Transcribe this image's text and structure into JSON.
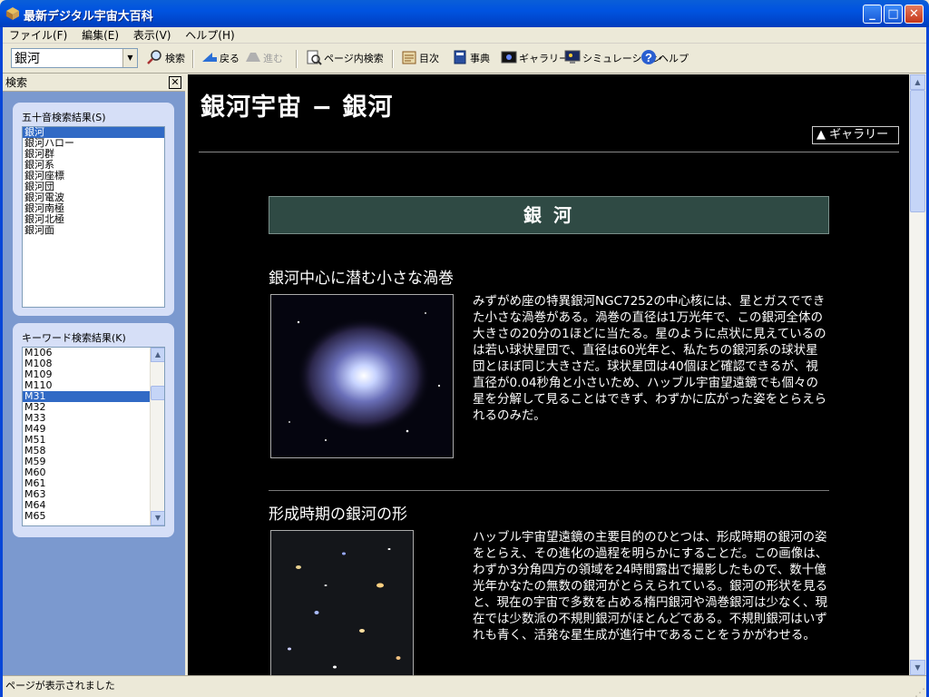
{
  "window": {
    "title": "最新デジタル宇宙大百科",
    "minimize": "_",
    "maximize": "□",
    "close": "✕"
  },
  "menu": [
    "ファイル(F)",
    "編集(E)",
    "表示(V)",
    "ヘルプ(H)"
  ],
  "toolbar": {
    "search_value": "銀河",
    "search": "検索",
    "back": "戻る",
    "forward": "進む",
    "page_search": "ページ内検索",
    "toc": "目次",
    "dictionary": "事典",
    "gallery": "ギャラリー",
    "simulation": "シミュレーション",
    "help": "ヘルプ"
  },
  "search_pane": {
    "title": "検索",
    "kana_label": "五十音検索結果(S)",
    "kana_results": [
      "銀河",
      "銀河ハロー",
      "銀河群",
      "銀河系",
      "銀河座標",
      "銀河団",
      "銀河電波",
      "銀河南極",
      "銀河北極",
      "銀河面"
    ],
    "kana_selected": 0,
    "keyword_label": "キーワード検索結果(K)",
    "keyword_results": [
      "M106",
      "M108",
      "M109",
      "M110",
      "M31",
      "M32",
      "M33",
      "M49",
      "M51",
      "M58",
      "M59",
      "M60",
      "M61",
      "M63",
      "M64",
      "M65"
    ],
    "keyword_selected": 4
  },
  "page": {
    "heading": "銀河宇宙 − 銀河",
    "gallery_link": "▲ ギャラリー",
    "section_title": "銀 河",
    "articles": [
      {
        "title": "銀河中心に潜む小さな渦巻",
        "text": "みずがめ座の特異銀河NGC7252の中心核には、星とガスでできた小さな渦巻がある。渦巻の直径は1万光年で、この銀河全体の大きさの20分の1ほどに当たる。星のように点状に見えているのは若い球状星団で、直径は60光年と、私たちの銀河系の球状星団とほぼ同じ大きさだ。球状星団は40個ほど確認できるが、視直径が0.04秒角と小さいため、ハッブル宇宙望遠鏡でも個々の星を分解して見ることはできず、わずかに広がった姿をとらえられるのみだ。"
      },
      {
        "title": "形成時期の銀河の形",
        "text": "ハッブル宇宙望遠鏡の主要目的のひとつは、形成時期の銀河の姿をとらえ、その進化の過程を明らかにすることだ。この画像は、わずか3分角四方の領域を24時間露出で撮影したもので、数十億光年かなたの無数の銀河がとらえられている。銀河の形状を見ると、現在の宇宙で多数を占める楕円銀河や渦巻銀河は少なく、現在では少数派の不規則銀河がほとんどである。不規則銀河はいずれも青く、活発な星生成が進行中であることをうかがわせる。"
      }
    ]
  },
  "status": "ページが表示されました"
}
